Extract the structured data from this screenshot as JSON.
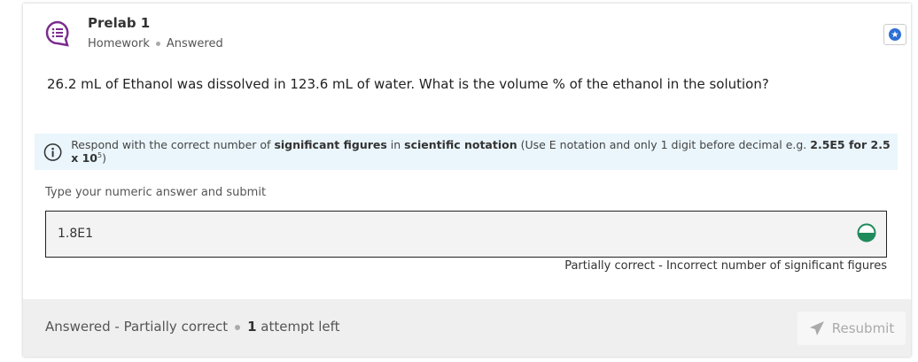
{
  "colors": {
    "accent_purple": "#7b2d8e",
    "star_blue": "#2f6fd6",
    "success_green": "#1f8a5b",
    "info_bg": "#eaf6fc"
  },
  "header": {
    "title": "Prelab 1",
    "type": "Homework",
    "status": "Answered"
  },
  "question": {
    "text": "26.2 mL of Ethanol was dissolved in 123.6 mL of water. What is the volume % of the ethanol in the solution?"
  },
  "info": {
    "part1": "Respond with the correct number of ",
    "bold1": "significant figures",
    "part2": " in ",
    "bold2": "scientific notation",
    "part3": " (Use E notation and only 1 digit before decimal e.g. ",
    "bold3": "2.5E5 for 2.5 x 10",
    "sup": "5",
    "part4": ")"
  },
  "answer": {
    "prompt": "Type your numeric answer and submit",
    "value": "1.8E1",
    "feedback": "Partially correct - Incorrect number of significant figures"
  },
  "footer": {
    "status": "Answered - Partially correct",
    "attempts_count": "1",
    "attempts_label": " attempt left",
    "resubmit_label": "Resubmit"
  },
  "icons": {
    "question": "chat-list-icon",
    "star": "star-icon",
    "info": "info-icon",
    "status": "half-circle-icon",
    "send": "paper-plane-icon"
  }
}
